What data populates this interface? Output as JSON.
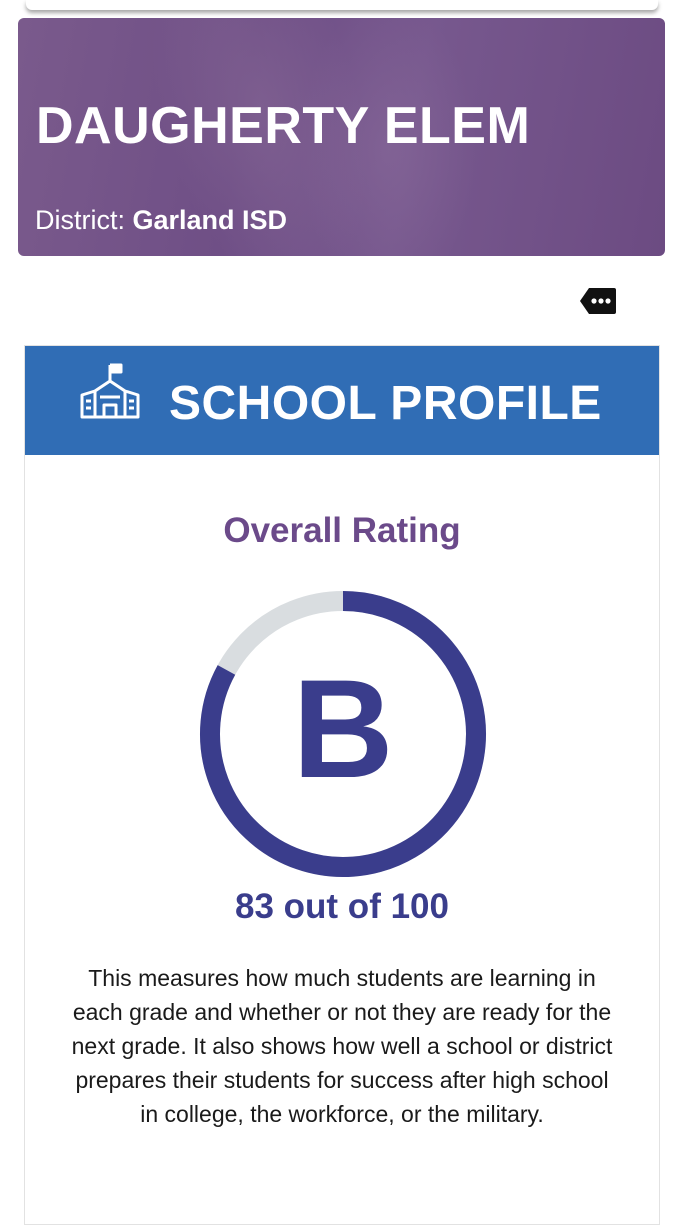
{
  "banner": {
    "school_name": "DAUGHERTY ELEM",
    "district_label": "District:",
    "district_value": "Garland ISD"
  },
  "more_button": {
    "icon": "more-horizontal-icon"
  },
  "profile": {
    "icon": "school-building-icon",
    "title": "SCHOOL PROFILE",
    "rating_heading": "Overall Rating",
    "grade_letter": "B",
    "score": 83,
    "score_max": 100,
    "score_text": "83 out of 100",
    "description": "This measures how much students are learning in each grade and whether or not they are ready for the next grade. It also shows how well a school or district prepares their students for success after high school in college, the workforce, or the military."
  },
  "colors": {
    "banner_purple": "#72538a",
    "header_blue": "#306db5",
    "heading_purple": "#6b4a8a",
    "gauge_navy": "#3a3d8c",
    "gauge_track": "#d9dde0"
  }
}
